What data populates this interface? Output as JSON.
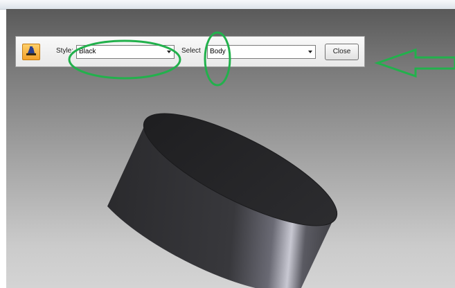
{
  "toolbar": {
    "style_label": "Style:",
    "style_value": "Black",
    "select_label": "Select",
    "select_value": "Body",
    "close_label": "Close",
    "icon": "appearance-style-icon"
  },
  "colors": {
    "annotation": "#22b14c",
    "toolbar_icon_bg": "#f3a12a",
    "model_body": "#2f2f32"
  }
}
